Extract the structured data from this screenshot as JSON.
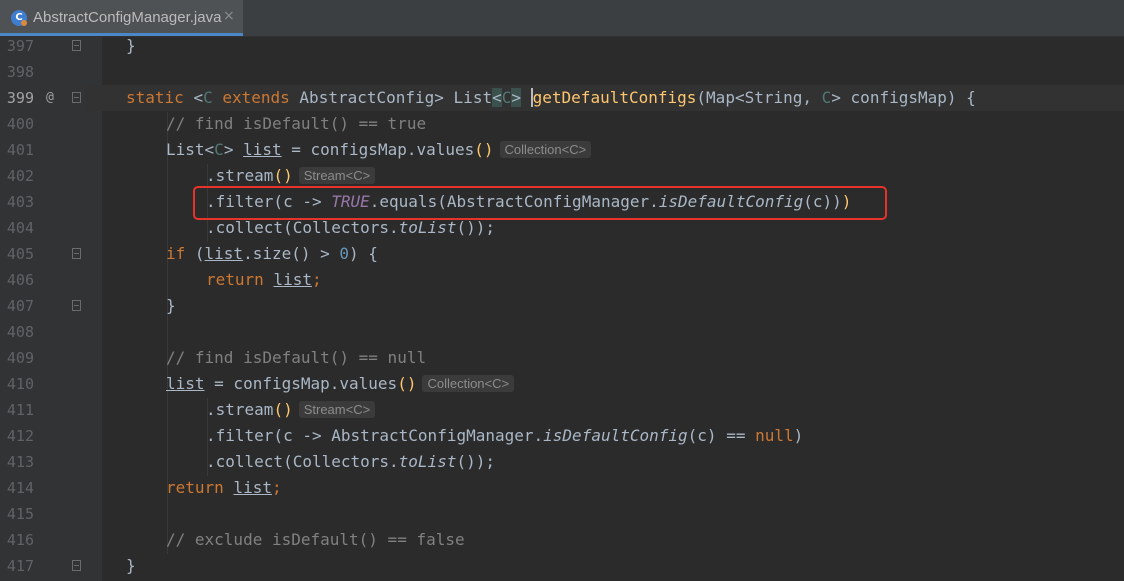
{
  "tab": {
    "icon_letter": "C",
    "label": "AbstractConfigManager.java",
    "close": "×"
  },
  "gutter": {
    "annotation_marker": "@"
  },
  "lines": {
    "l397": {
      "num": "397",
      "brace": "}"
    },
    "l398": {
      "num": "398"
    },
    "l399": {
      "num": "399",
      "static": "static ",
      "lt1": "<",
      "tparam": "C",
      "extends": " extends ",
      "aclass": "AbstractConfig",
      "gt1": "> ",
      "list": "List",
      "lt2": "<",
      "tparam2": "C",
      "gt2": ">",
      "method": "getDefaultConfigs",
      "open": "(",
      "map": "Map<String, ",
      "tparam3": "C",
      "mapclose": "> configsMap) {"
    },
    "l400": {
      "num": "400",
      "text": "// find isDefault() == true"
    },
    "l401": {
      "num": "401",
      "list": "List",
      "lt": "<",
      "tparam": "C",
      "gt": "> ",
      "var": "list",
      "rest": " = configsMap.values",
      "parens": "()",
      "hint": "Collection<C>"
    },
    "l402": {
      "num": "402",
      "call": ".stream",
      "parens": "()",
      "hint": "Stream<C>"
    },
    "l403": {
      "num": "403",
      "pre": ".filter(c -> ",
      "const": "TRUE",
      "mid": ".equals(AbstractConfigManager.",
      "method": "isDefaultConfig",
      "args": "(c))",
      "close": ")"
    },
    "l404": {
      "num": "404",
      "pre": ".collect(Collectors.",
      "method": "toList",
      "post": "());"
    },
    "l405": {
      "num": "405",
      "kw": "if",
      "pre": " (",
      "var": "list",
      "mid": ".size() > ",
      "number": "0",
      "post": ") {"
    },
    "l406": {
      "num": "406",
      "kw": "return ",
      "var": "list",
      "semi": ";"
    },
    "l407": {
      "num": "407",
      "brace": "}"
    },
    "l408": {
      "num": "408"
    },
    "l409": {
      "num": "409",
      "text": "// find isDefault() == null"
    },
    "l410": {
      "num": "410",
      "var": "list",
      "rest": " = configsMap.values",
      "parens": "()",
      "hint": "Collection<C>"
    },
    "l411": {
      "num": "411",
      "call": ".stream",
      "parens": "()",
      "hint": "Stream<C>"
    },
    "l412": {
      "num": "412",
      "pre": ".filter(c -> AbstractConfigManager.",
      "method": "isDefaultConfig",
      "mid": "(c) == ",
      "kw": "null",
      "post": ")"
    },
    "l413": {
      "num": "413",
      "pre": ".collect(Collectors.",
      "method": "toList",
      "post": "());"
    },
    "l414": {
      "num": "414",
      "kw": "return ",
      "var": "list",
      "semi": ";"
    },
    "l415": {
      "num": "415"
    },
    "l416": {
      "num": "416",
      "text": "// exclude isDefault() == false"
    },
    "l417": {
      "num": "417",
      "brace": "}"
    }
  },
  "colors": {
    "keyword": "#cc7832",
    "comment": "#808080",
    "method": "#ffc66d",
    "constant": "#9876aa",
    "number": "#6897bb",
    "highlight_box": "#e8332a"
  }
}
